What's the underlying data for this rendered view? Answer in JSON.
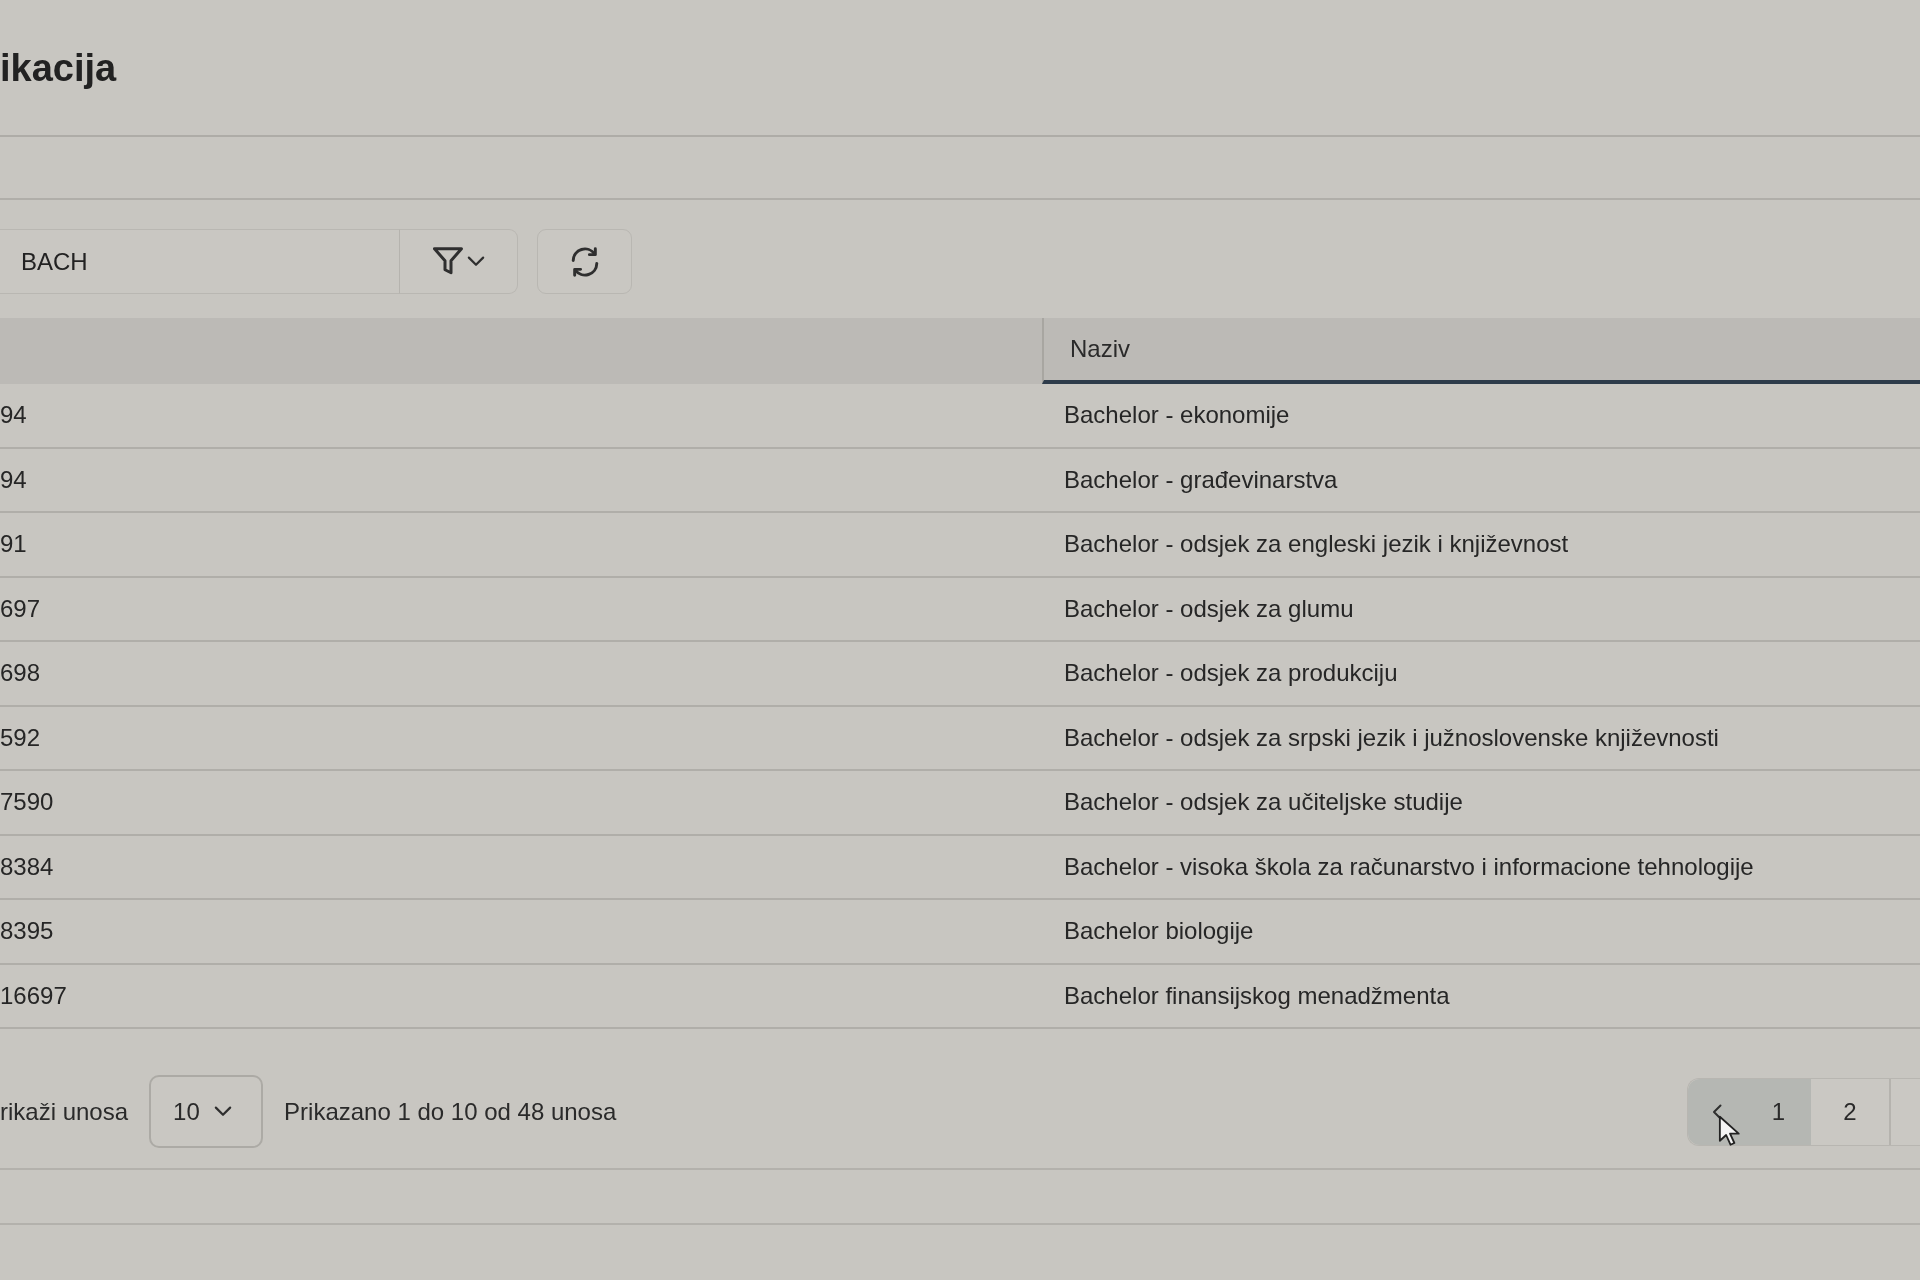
{
  "page": {
    "title": "ikacija"
  },
  "toolbar": {
    "search": {
      "value": "BACH"
    }
  },
  "table": {
    "header": {
      "label": "Naziv",
      "sorted": true
    },
    "rows": [
      {
        "column_1": "94",
        "naziv": "Bachelor - ekonomije"
      },
      {
        "column_1": "94",
        "naziv": "Bachelor - građevinarstva"
      },
      {
        "column_1": "91",
        "naziv": "Bachelor - odsjek za engleski jezik i književnost"
      },
      {
        "column_1": "697",
        "naziv": "Bachelor - odsjek za glumu"
      },
      {
        "column_1": "698",
        "naziv": "Bachelor - odsjek za produkciju"
      },
      {
        "column_1": "592",
        "naziv": "Bachelor - odsjek za srpski jezik i južnoslovenske književnosti"
      },
      {
        "column_1": "7590",
        "naziv": "Bachelor - odsjek za učiteljske studije"
      },
      {
        "column_1": "8384",
        "naziv": "Bachelor - visoka škola za računarstvo i informacione tehnologije"
      },
      {
        "column_1": "8395",
        "naziv": "Bachelor biologije"
      },
      {
        "column_1": "16697",
        "naziv": "Bachelor finansijskog menadžmenta"
      }
    ]
  },
  "footer": {
    "page_size_label": "rikaži unosa",
    "page_size": "10",
    "summary": "Prikazano 1 do 10 od 48 unosa",
    "pagination": {
      "previous": {
        "hovered": true
      },
      "pages": [
        {
          "label": "1",
          "selected": true
        },
        {
          "label": "2",
          "selected": false
        }
      ]
    }
  }
}
